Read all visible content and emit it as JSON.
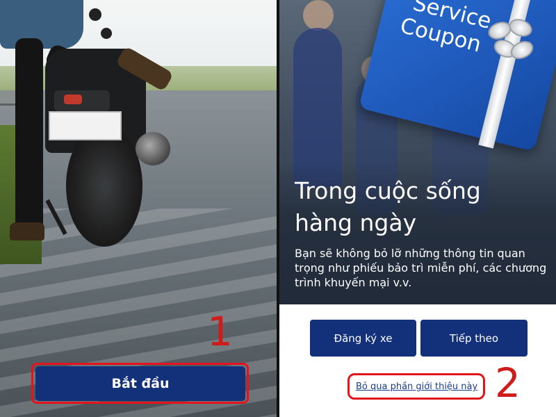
{
  "colors": {
    "primary_button": "#13307a",
    "highlight": "#e3141b",
    "link": "#1a3d8f",
    "coupon_blue": "#2a6fd6"
  },
  "left_screen": {
    "start_button_label": "Bắt đầu",
    "step_number": "1"
  },
  "right_screen": {
    "coupon": {
      "line1": "Service",
      "line2": "Coupon",
      "bow_icon": "gift-bow-icon"
    },
    "heading": "Trong cuộc sống hàng ngày",
    "body": "Bạn sẽ không bỏ lỡ những thông tin quan trọng như phiếu bảo trì miễn phí, các chương trình khuyến mại  v.v.",
    "buttons": {
      "register_label": "Đăng ký xe",
      "next_label": "Tiếp theo"
    },
    "skip_link": "Bỏ qua phần giới thiệu này",
    "step_number": "2"
  }
}
